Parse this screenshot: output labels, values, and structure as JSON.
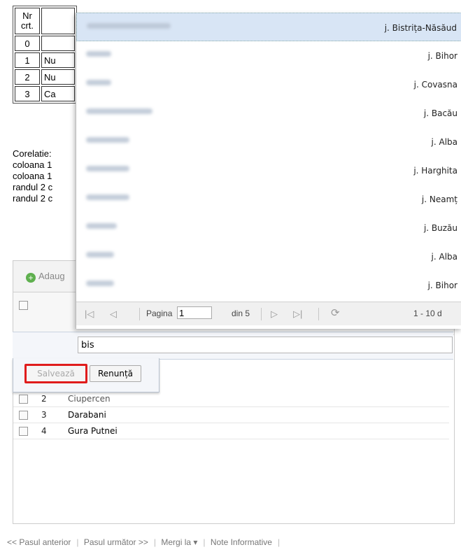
{
  "table": {
    "header": "Nr crt.",
    "rows": [
      {
        "nr": "0",
        "text": ""
      },
      {
        "nr": "1",
        "text": "Nu"
      },
      {
        "nr": "2",
        "text": "Nu"
      },
      {
        "nr": "3",
        "text": "Ca"
      }
    ]
  },
  "corelatie": [
    "Corelatie:",
    "coloana 1",
    "coloana 1",
    "randul 2 c",
    "randul 2 c"
  ],
  "grid": {
    "add_label": "Adaug",
    "rows": [
      {
        "num": "2",
        "name": "Ciupercen"
      },
      {
        "num": "3",
        "name": "Darabani"
      },
      {
        "num": "4",
        "name": "Gura Putnei"
      }
    ]
  },
  "dropdown": {
    "items": [
      {
        "loc": "j. Bistrița-Năsăud",
        "selected": true
      },
      {
        "loc": "j. Bihor"
      },
      {
        "loc": "j. Covasna"
      },
      {
        "loc": "j. Bacău"
      },
      {
        "loc": "j. Alba"
      },
      {
        "loc": "j. Harghita"
      },
      {
        "loc": "j. Neamț"
      },
      {
        "loc": "j. Buzău"
      },
      {
        "loc": "j. Alba"
      },
      {
        "loc": "j. Bihor"
      }
    ],
    "paging": {
      "page_label": "Pagina",
      "page_value": "1",
      "of_label": "din 5",
      "range": "1 - 10 d"
    }
  },
  "editor": {
    "value": "bis",
    "save_label": "Salvează",
    "cancel_label": "Renunță"
  },
  "footer": {
    "prev": "<< Pasul anterior",
    "next": "Pasul următor >>",
    "goto": "Mergi la ▾",
    "notes": "Note Informative"
  }
}
